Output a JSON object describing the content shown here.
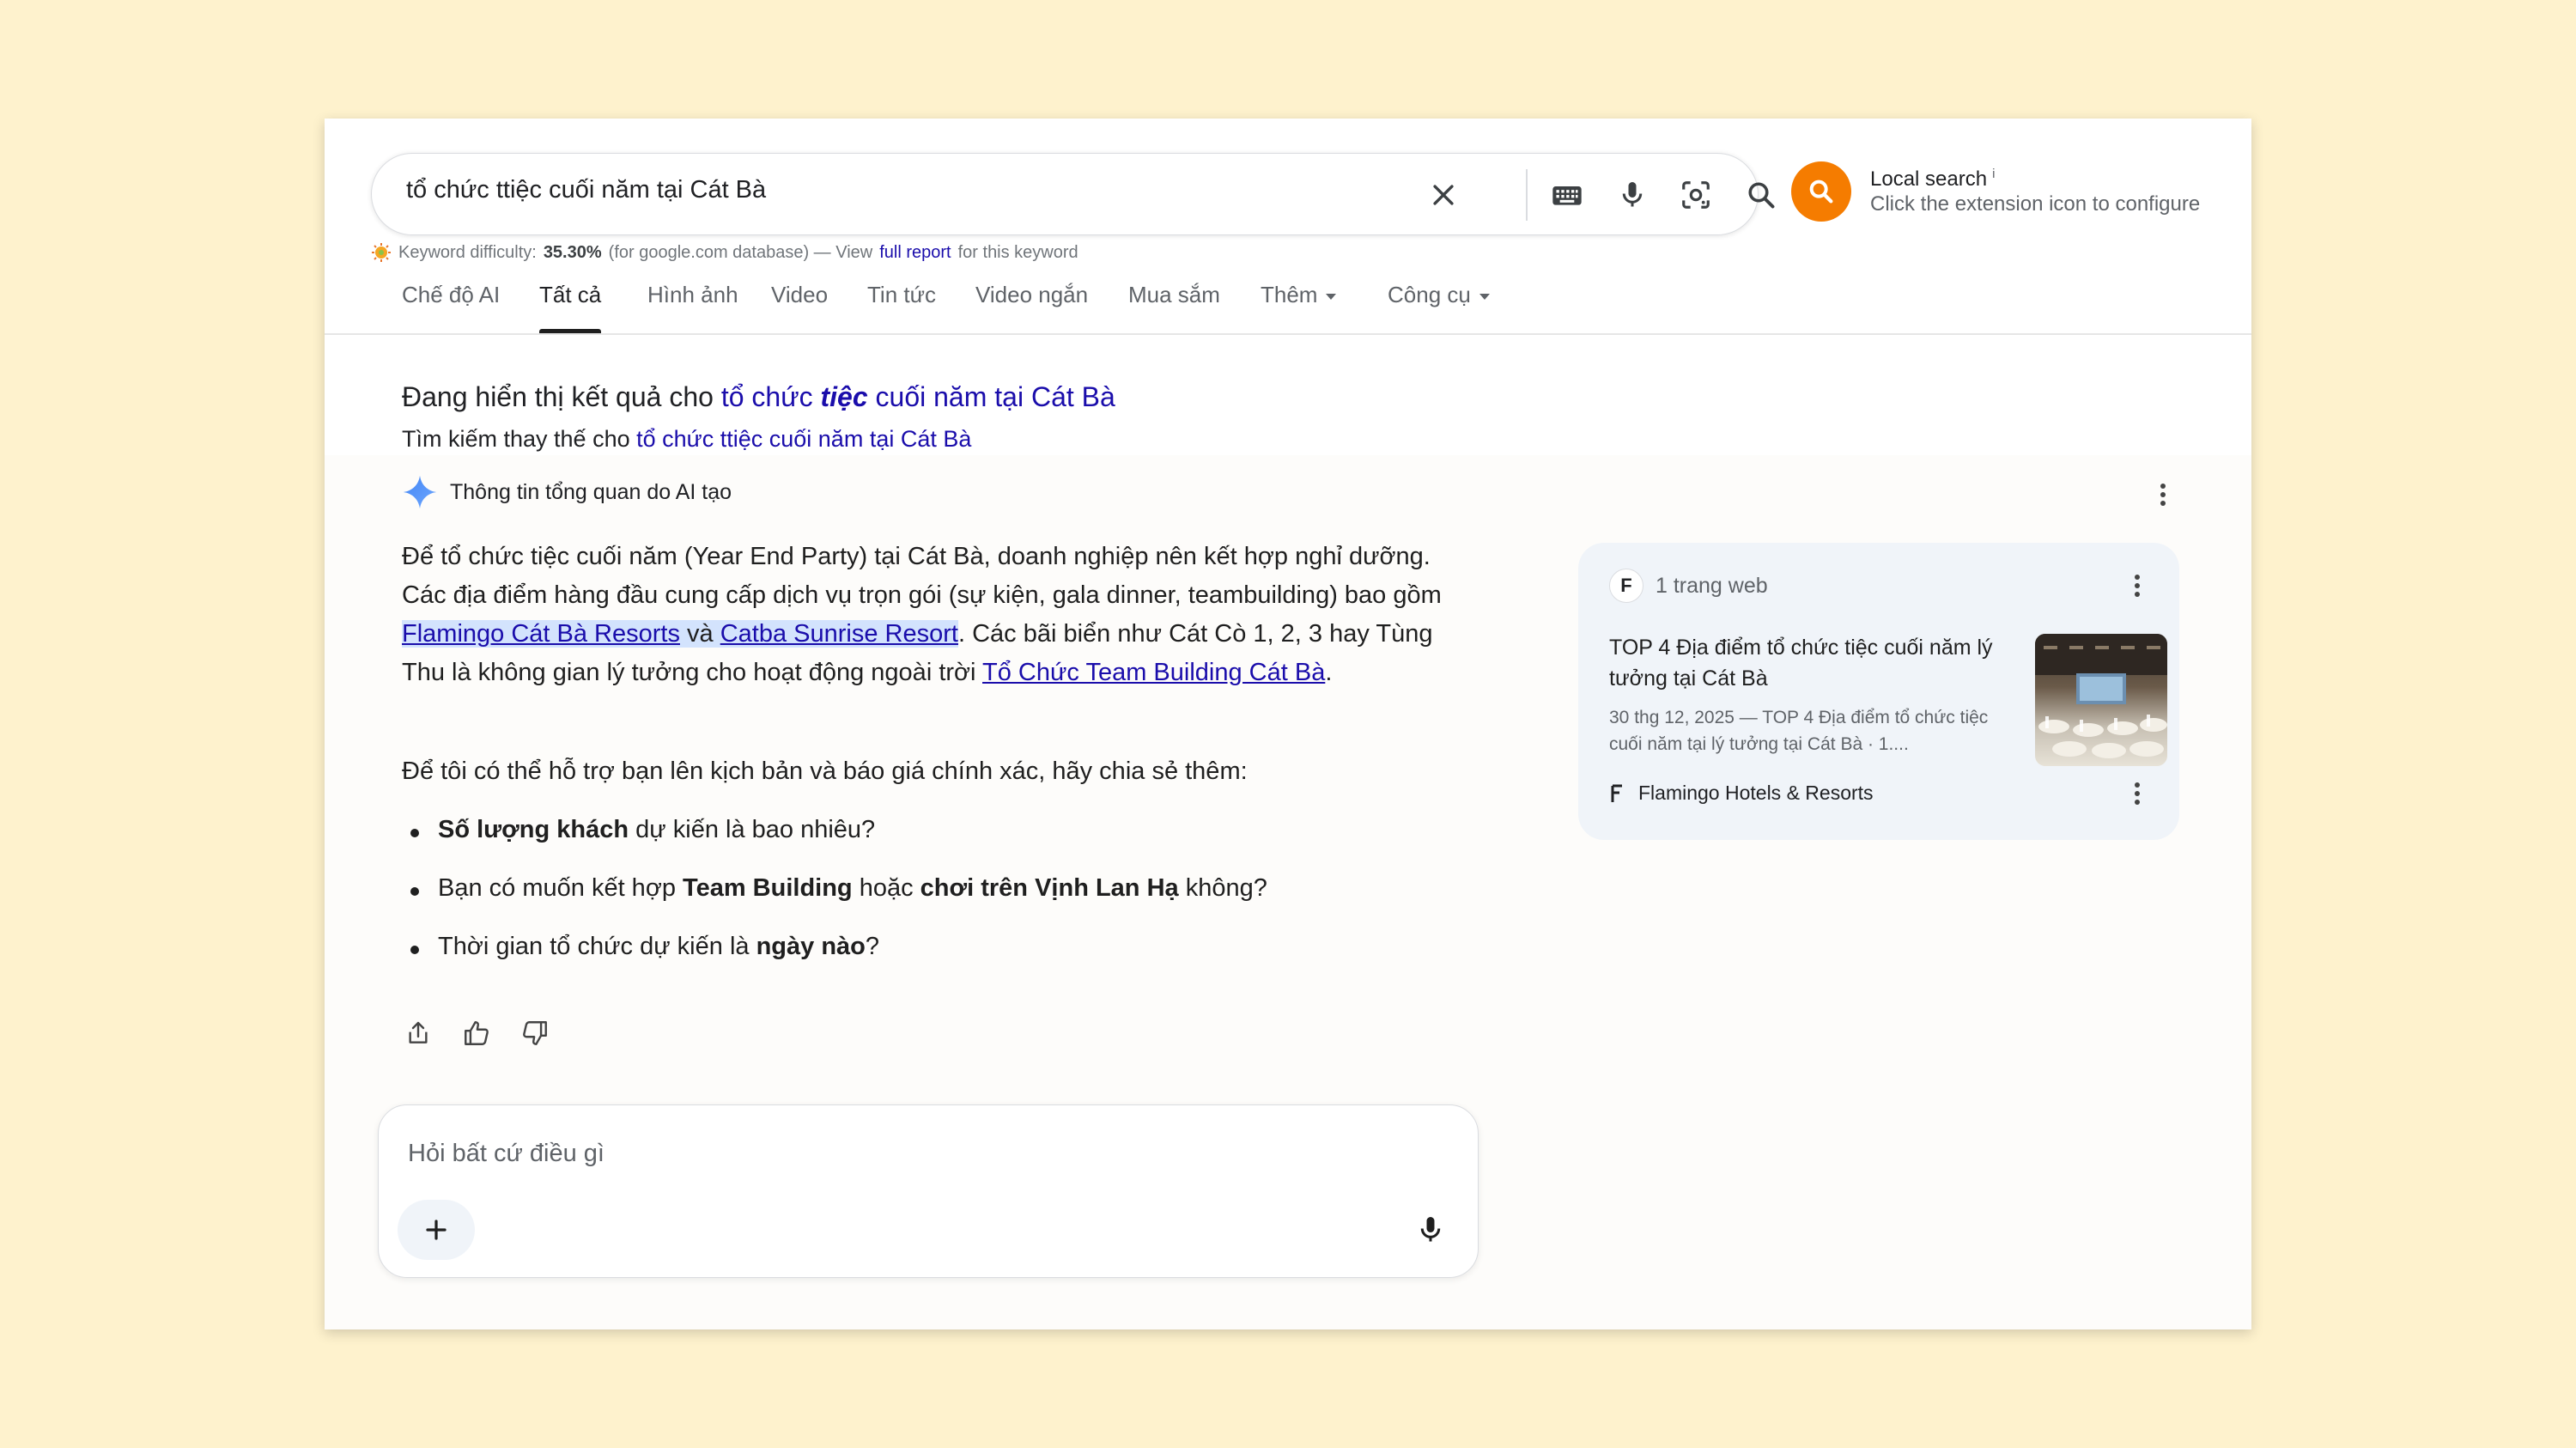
{
  "search": {
    "query": "tổ chức ttiệc cuối năm tại Cát Bà"
  },
  "extension": {
    "title": "Local search",
    "info_mark": "i",
    "subtitle": "Click the extension icon to configure"
  },
  "keyword_difficulty": {
    "label": "Keyword difficulty:",
    "value": "35.30%",
    "database_text": "(for google.com database) — View",
    "link": "full report",
    "suffix": "for this keyword"
  },
  "tabs": [
    {
      "label": "Chế độ AI"
    },
    {
      "label": "Tất cả"
    },
    {
      "label": "Hình ảnh"
    },
    {
      "label": "Video"
    },
    {
      "label": "Tin tức"
    },
    {
      "label": "Video ngắn"
    },
    {
      "label": "Mua sắm"
    },
    {
      "label": "Thêm"
    },
    {
      "label": "Công cụ"
    }
  ],
  "correction": {
    "showing_prefix": "Đang hiển thị kết quả cho",
    "corrected_1": "tổ chức",
    "corrected_bold": "tiệc",
    "corrected_2": "cuối năm tại Cát Bà",
    "instead_prefix": "Tìm kiếm thay thế cho",
    "instead_link": "tổ chức ttiệc cuối năm tại Cát Bà"
  },
  "ai_overview": {
    "header": "Thông tin tổng quan do AI tạo",
    "p1_text1": "Để tổ chức tiệc cuối năm (Year End Party) tại Cát Bà, doanh nghiệp nên kết hợp nghỉ dưỡng. Các địa điểm hàng đầu cung cấp dịch vụ trọn gói (sự kiện, gala dinner, teambuilding) bao gồm ",
    "p1_link1": "Flamingo Cát Bà Resorts",
    "p1_and": " và ",
    "p1_link2": "Catba Sunrise Resort",
    "p1_text2": ". Các bãi biển như Cát Cò 1, 2, 3 hay Tùng Thu là không gian lý tưởng cho hoạt động ngoài trời ",
    "p1_link3": "Tổ Chức Team Building Cát Bà",
    "p1_end": ".",
    "p2": "Để tôi có thể hỗ trợ bạn lên kịch bản và báo giá chính xác, hãy chia sẻ thêm:",
    "b1_bold": "Số lượng khách",
    "b1_rest": " dự kiến là bao nhiêu?",
    "b2_pre": "Bạn có muốn kết hợp ",
    "b2_bold1": "Team Building",
    "b2_mid": " hoặc ",
    "b2_bold2": "chơi trên Vịnh Lan Hạ",
    "b2_rest": " không?",
    "b3_pre": "Thời gian tổ chức dự kiến là ",
    "b3_bold": "ngày nào",
    "b3_rest": "?"
  },
  "ask_box": {
    "placeholder": "Hỏi bất cứ điều gì"
  },
  "source_card": {
    "favicon_letter": "F",
    "count": "1 trang web",
    "title": "TOP 4 Địa điểm tổ chức tiệc cuối năm lý tưởng tại Cát Bà",
    "snippet": "30 thg 12, 2025 — TOP 4 Địa điểm tổ chức tiệc cuối năm tại lý tưởng tại Cát Bà · 1....",
    "site": "Flamingo Hotels & Resorts"
  },
  "colors": {
    "link": "#1a0dab",
    "extension": "#f57c00",
    "background": "#fef2cd"
  }
}
